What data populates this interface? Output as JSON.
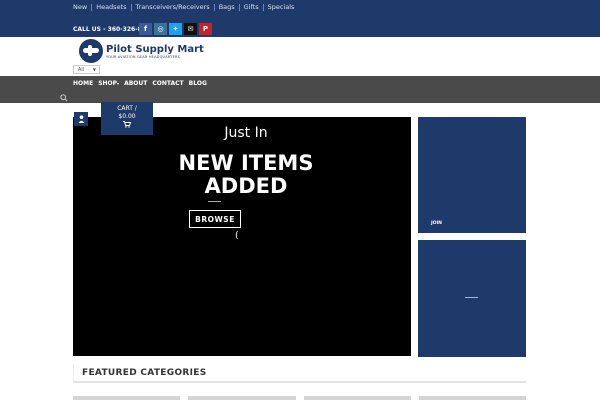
{
  "topnav": {
    "items": [
      "New",
      "Headsets",
      "Transceivers/Receivers",
      "Bags",
      "Gifts",
      "Specials"
    ]
  },
  "header": {
    "callus": "CALL US - 360-326-810",
    "social": [
      {
        "icon": "facebook-icon",
        "glyph": "f",
        "color": "#3b5998"
      },
      {
        "icon": "instagram-icon",
        "glyph": "◎",
        "color": "#3f729b"
      },
      {
        "icon": "twitter-icon",
        "glyph": "✦",
        "color": "#1da1f2"
      },
      {
        "icon": "email-icon",
        "glyph": "✉",
        "color": "#111111"
      },
      {
        "icon": "pinterest-icon",
        "glyph": "P",
        "color": "#cb2027"
      }
    ],
    "logo_name": "Pilot Supply Mart",
    "logo_tagline": "YOUR AVIATION GEAR HEADQUARTERS",
    "category_select": "All"
  },
  "mainnav": {
    "items": [
      "HOME",
      "SHOP",
      "ABOUT",
      "CONTACT",
      "BLOG"
    ]
  },
  "cart": {
    "label": "CART /",
    "amount": "$0.00"
  },
  "hero": {
    "kicker": "Just In",
    "headline_1": "NEW ITEMS",
    "headline_2": "ADDED",
    "cta": "BROWSE",
    "paren": "("
  },
  "banners": {
    "join": "JOIN"
  },
  "featured": {
    "title": "FEATURED CATEGORIES"
  },
  "colors": {
    "brand": "#1e3a6b",
    "nav": "#4a4a4a"
  }
}
